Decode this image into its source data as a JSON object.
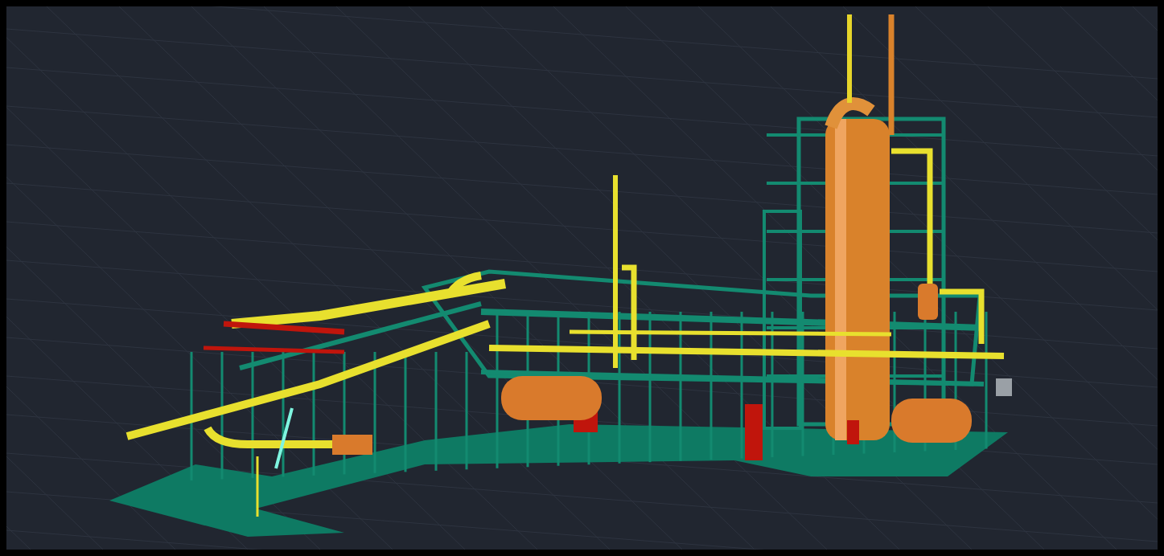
{
  "viewport": {
    "kind": "plant-model"
  }
}
